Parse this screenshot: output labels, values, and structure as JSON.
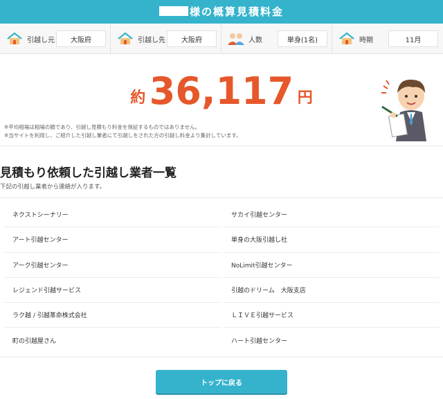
{
  "header": {
    "title_suffix": "様の概算見積料金"
  },
  "info": [
    {
      "icon": "house-icon",
      "label": "引越し元",
      "value": "大阪府"
    },
    {
      "icon": "house-icon",
      "label": "引越し先",
      "value": "大阪府"
    },
    {
      "icon": "people-icon",
      "label": "人数",
      "value": "単身(1名)"
    },
    {
      "icon": "house-icon",
      "label": "時期",
      "value": "11月"
    }
  ],
  "price": {
    "prefix": "約",
    "amount": "36,117",
    "suffix": "円"
  },
  "notes": [
    "※平均相場は相場の額であり、引越し見積もり料金を保証するものではありません。",
    "※当サイトを利用し、ご紹介した引越し業者にて引越しをされた方の引越し料金より集計しています。"
  ],
  "section": {
    "title": "見積もり依頼した引越し業者一覧",
    "subtitle": "下記の引越し業者から連絡が入ります。"
  },
  "companies_left": [
    "ネクストシーナリー",
    "アート引越センター",
    "アーク引越センター",
    "レジェンド引越サービス",
    "ラク越 / 引越革命株式会社",
    "町の引越屋さん"
  ],
  "companies_right": [
    "サカイ引越センター",
    "単身の大阪引越し社",
    "NoLimit引越センター",
    "引越のドリーム　大阪支店",
    "ＬＩＶＥ引越サービス",
    "ハート引越センター"
  ],
  "button": {
    "label": "トップに戻る"
  },
  "colors": {
    "accent": "#35b3cc",
    "price": "#e6582b"
  }
}
